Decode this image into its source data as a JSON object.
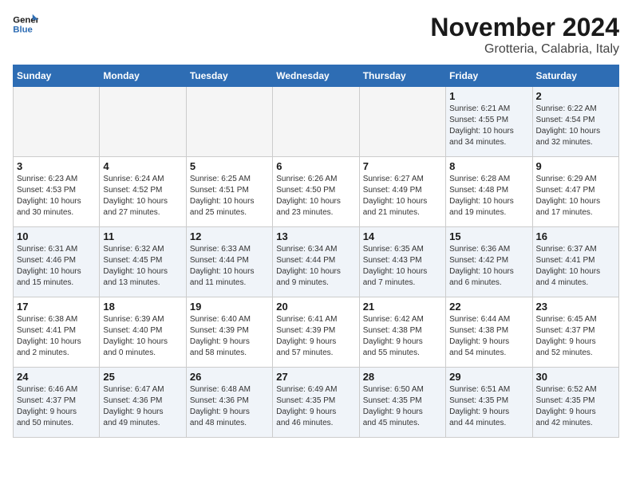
{
  "header": {
    "logo_line1": "General",
    "logo_line2": "Blue",
    "month": "November 2024",
    "location": "Grotteria, Calabria, Italy"
  },
  "weekdays": [
    "Sunday",
    "Monday",
    "Tuesday",
    "Wednesday",
    "Thursday",
    "Friday",
    "Saturday"
  ],
  "weeks": [
    [
      {
        "day": "",
        "info": ""
      },
      {
        "day": "",
        "info": ""
      },
      {
        "day": "",
        "info": ""
      },
      {
        "day": "",
        "info": ""
      },
      {
        "day": "",
        "info": ""
      },
      {
        "day": "1",
        "info": "Sunrise: 6:21 AM\nSunset: 4:55 PM\nDaylight: 10 hours\nand 34 minutes."
      },
      {
        "day": "2",
        "info": "Sunrise: 6:22 AM\nSunset: 4:54 PM\nDaylight: 10 hours\nand 32 minutes."
      }
    ],
    [
      {
        "day": "3",
        "info": "Sunrise: 6:23 AM\nSunset: 4:53 PM\nDaylight: 10 hours\nand 30 minutes."
      },
      {
        "day": "4",
        "info": "Sunrise: 6:24 AM\nSunset: 4:52 PM\nDaylight: 10 hours\nand 27 minutes."
      },
      {
        "day": "5",
        "info": "Sunrise: 6:25 AM\nSunset: 4:51 PM\nDaylight: 10 hours\nand 25 minutes."
      },
      {
        "day": "6",
        "info": "Sunrise: 6:26 AM\nSunset: 4:50 PM\nDaylight: 10 hours\nand 23 minutes."
      },
      {
        "day": "7",
        "info": "Sunrise: 6:27 AM\nSunset: 4:49 PM\nDaylight: 10 hours\nand 21 minutes."
      },
      {
        "day": "8",
        "info": "Sunrise: 6:28 AM\nSunset: 4:48 PM\nDaylight: 10 hours\nand 19 minutes."
      },
      {
        "day": "9",
        "info": "Sunrise: 6:29 AM\nSunset: 4:47 PM\nDaylight: 10 hours\nand 17 minutes."
      }
    ],
    [
      {
        "day": "10",
        "info": "Sunrise: 6:31 AM\nSunset: 4:46 PM\nDaylight: 10 hours\nand 15 minutes."
      },
      {
        "day": "11",
        "info": "Sunrise: 6:32 AM\nSunset: 4:45 PM\nDaylight: 10 hours\nand 13 minutes."
      },
      {
        "day": "12",
        "info": "Sunrise: 6:33 AM\nSunset: 4:44 PM\nDaylight: 10 hours\nand 11 minutes."
      },
      {
        "day": "13",
        "info": "Sunrise: 6:34 AM\nSunset: 4:44 PM\nDaylight: 10 hours\nand 9 minutes."
      },
      {
        "day": "14",
        "info": "Sunrise: 6:35 AM\nSunset: 4:43 PM\nDaylight: 10 hours\nand 7 minutes."
      },
      {
        "day": "15",
        "info": "Sunrise: 6:36 AM\nSunset: 4:42 PM\nDaylight: 10 hours\nand 6 minutes."
      },
      {
        "day": "16",
        "info": "Sunrise: 6:37 AM\nSunset: 4:41 PM\nDaylight: 10 hours\nand 4 minutes."
      }
    ],
    [
      {
        "day": "17",
        "info": "Sunrise: 6:38 AM\nSunset: 4:41 PM\nDaylight: 10 hours\nand 2 minutes."
      },
      {
        "day": "18",
        "info": "Sunrise: 6:39 AM\nSunset: 4:40 PM\nDaylight: 10 hours\nand 0 minutes."
      },
      {
        "day": "19",
        "info": "Sunrise: 6:40 AM\nSunset: 4:39 PM\nDaylight: 9 hours\nand 58 minutes."
      },
      {
        "day": "20",
        "info": "Sunrise: 6:41 AM\nSunset: 4:39 PM\nDaylight: 9 hours\nand 57 minutes."
      },
      {
        "day": "21",
        "info": "Sunrise: 6:42 AM\nSunset: 4:38 PM\nDaylight: 9 hours\nand 55 minutes."
      },
      {
        "day": "22",
        "info": "Sunrise: 6:44 AM\nSunset: 4:38 PM\nDaylight: 9 hours\nand 54 minutes."
      },
      {
        "day": "23",
        "info": "Sunrise: 6:45 AM\nSunset: 4:37 PM\nDaylight: 9 hours\nand 52 minutes."
      }
    ],
    [
      {
        "day": "24",
        "info": "Sunrise: 6:46 AM\nSunset: 4:37 PM\nDaylight: 9 hours\nand 50 minutes."
      },
      {
        "day": "25",
        "info": "Sunrise: 6:47 AM\nSunset: 4:36 PM\nDaylight: 9 hours\nand 49 minutes."
      },
      {
        "day": "26",
        "info": "Sunrise: 6:48 AM\nSunset: 4:36 PM\nDaylight: 9 hours\nand 48 minutes."
      },
      {
        "day": "27",
        "info": "Sunrise: 6:49 AM\nSunset: 4:35 PM\nDaylight: 9 hours\nand 46 minutes."
      },
      {
        "day": "28",
        "info": "Sunrise: 6:50 AM\nSunset: 4:35 PM\nDaylight: 9 hours\nand 45 minutes."
      },
      {
        "day": "29",
        "info": "Sunrise: 6:51 AM\nSunset: 4:35 PM\nDaylight: 9 hours\nand 44 minutes."
      },
      {
        "day": "30",
        "info": "Sunrise: 6:52 AM\nSunset: 4:35 PM\nDaylight: 9 hours\nand 42 minutes."
      }
    ]
  ]
}
